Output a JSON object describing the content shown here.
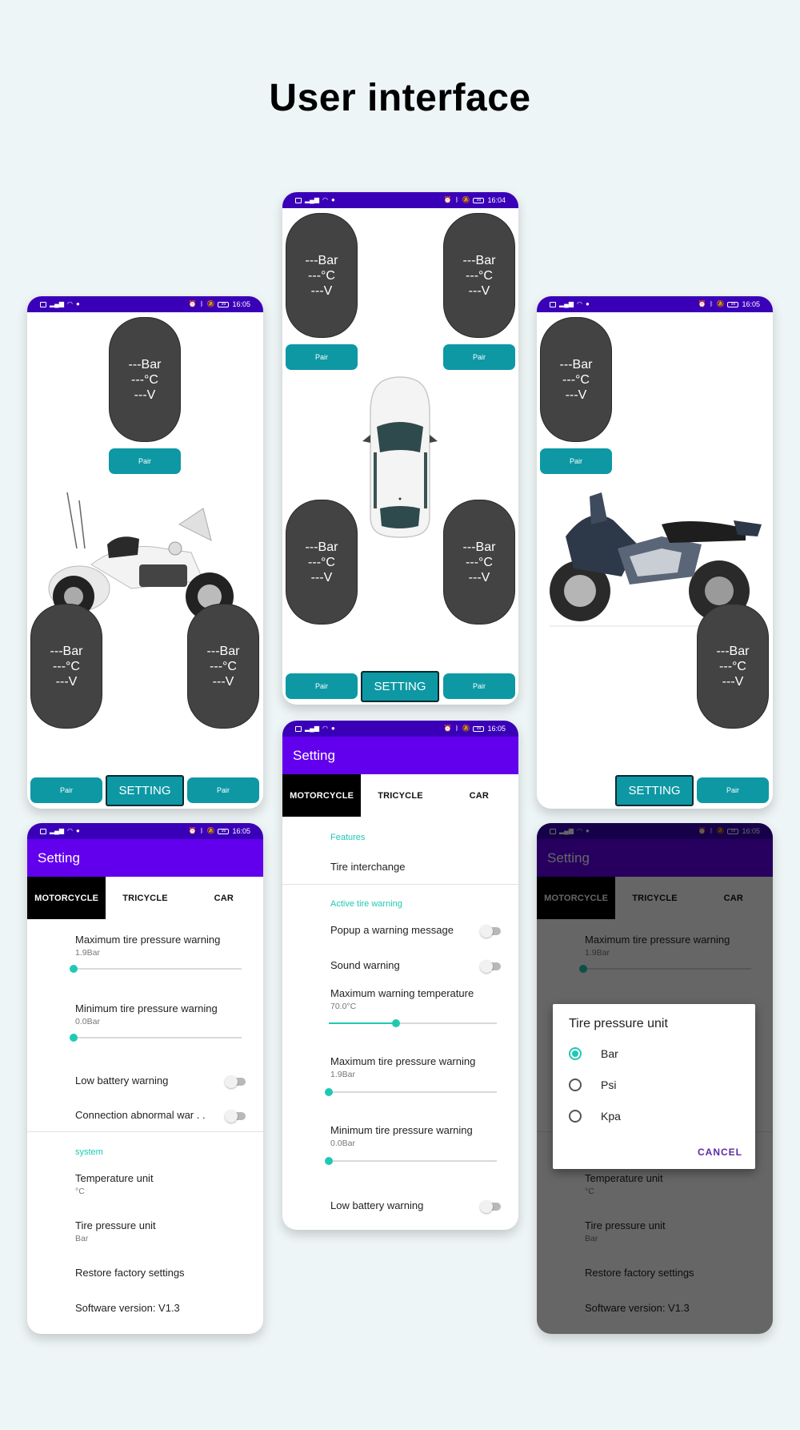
{
  "page": {
    "title": "User interface"
  },
  "status_bar": {
    "left_icons": [
      "hd-icon",
      "signal-icon",
      "wifi-icon",
      "data-saver-icon"
    ],
    "right_icons": [
      "alarm-icon",
      "bluetooth-icon",
      "mute-icon",
      "battery-icon"
    ],
    "battery_level": "99",
    "time_center_top": "16:04",
    "time_default": "16:05"
  },
  "tire_gauge": {
    "pressure": "---Bar",
    "temperature": "---°C",
    "voltage": "---V"
  },
  "buttons": {
    "pair": "Pair",
    "setting": "SETTING"
  },
  "screens": {
    "tricycle_main": {
      "vehicle": "tricycle",
      "tires": 3
    },
    "car_main": {
      "vehicle": "car",
      "tires": 4
    },
    "motorcycle_main": {
      "vehicle": "motorcycle",
      "tires": 2
    }
  },
  "settings": {
    "title": "Setting",
    "tabs": [
      {
        "label": "MOTORCYCLE",
        "active": true
      },
      {
        "label": "TRICYCLE",
        "active": false
      },
      {
        "label": "CAR",
        "active": false
      }
    ],
    "left_screen": {
      "max_pressure": {
        "title": "Maximum tire pressure warning",
        "value": "1.9Bar",
        "slider_fraction": 0.0
      },
      "min_pressure": {
        "title": "Minimum tire pressure warning",
        "value": "0.0Bar",
        "slider_fraction": 0.0
      },
      "low_battery": {
        "title": "Low battery warning",
        "on": false
      },
      "connection_abnormal": {
        "title": "Connection abnormal war . .",
        "on": false
      },
      "system_header": "system",
      "temperature_unit": {
        "title": "Temperature unit",
        "value": "°C"
      },
      "tire_pressure_unit": {
        "title": "Tire pressure unit",
        "value": "Bar"
      },
      "restore": "Restore factory settings",
      "version": "Software version: V1.3"
    },
    "middle_screen": {
      "features_header": "Features",
      "tire_interchange": "Tire interchange",
      "active_warning_header": "Active tire warning",
      "popup_warning": {
        "title": "Popup a warning message",
        "on": false
      },
      "sound_warning": {
        "title": "Sound warning",
        "on": false
      },
      "max_temperature": {
        "title": "Maximum warning temperature",
        "value": "70.0°C",
        "slider_fraction": 0.4
      },
      "max_pressure": {
        "title": "Maximum tire pressure warning",
        "value": "1.9Bar",
        "slider_fraction": 0.0
      },
      "min_pressure": {
        "title": "Minimum tire pressure warning",
        "value": "0.0Bar",
        "slider_fraction": 0.0
      },
      "low_battery": {
        "title": "Low battery warning",
        "on": false
      }
    },
    "dialog": {
      "title": "Tire pressure unit",
      "options": [
        {
          "label": "Bar",
          "checked": true
        },
        {
          "label": "Psi",
          "checked": false
        },
        {
          "label": "Kpa",
          "checked": false
        }
      ],
      "cancel": "CANCEL"
    }
  },
  "colors": {
    "status_bar": "#3a00b8",
    "app_bar": "#6200ee",
    "accent": "#1ec9b3",
    "button": "#0d98a4",
    "gauge": "#434343"
  }
}
